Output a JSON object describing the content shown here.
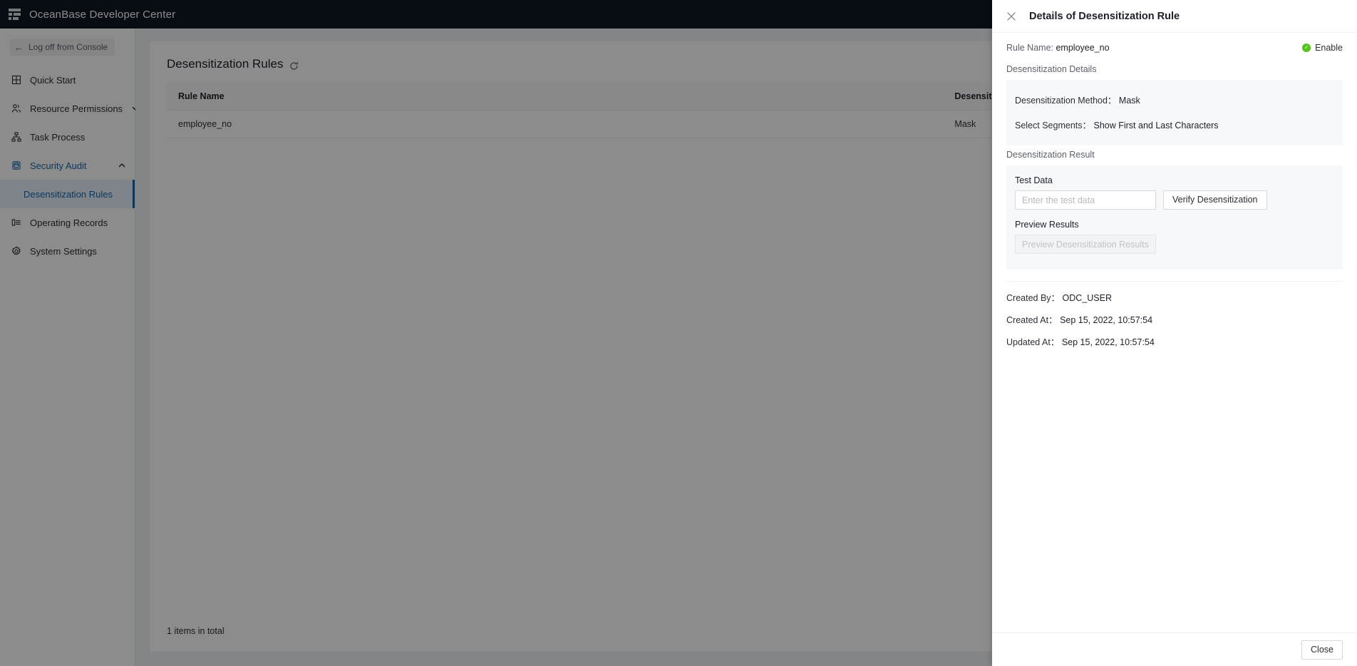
{
  "topbar": {
    "app_title": "OceanBase Developer Center",
    "logo_icon": "menu-logo-icon"
  },
  "sidebar": {
    "logoff": {
      "label": "Log off from Console",
      "icon": "arrow-left-icon"
    },
    "items": [
      {
        "label": "Quick Start",
        "icon": "grid-icon",
        "state": "normal",
        "expandable": false
      },
      {
        "label": "Resource Permissions",
        "icon": "users-icon",
        "state": "normal",
        "expandable": true,
        "caret": "chevron-down-icon"
      },
      {
        "label": "Task Process",
        "icon": "sitemap-icon",
        "state": "normal",
        "expandable": false
      },
      {
        "label": "Security Audit",
        "icon": "shield-db-icon",
        "state": "active",
        "expandable": true,
        "caret": "chevron-up-icon"
      },
      {
        "label": "Operating Records",
        "icon": "list-icon",
        "state": "normal",
        "expandable": false
      },
      {
        "label": "System Settings",
        "icon": "gear-icon",
        "state": "normal",
        "expandable": false
      }
    ],
    "subitem": {
      "label": "Desensitization Rules",
      "state": "selected"
    }
  },
  "main": {
    "page_title": "Desensitization Rules",
    "refresh_icon": "refresh-icon",
    "table": {
      "columns": [
        "Rule Name",
        "Desensit"
      ],
      "rows": [
        {
          "rule_name": "employee_no",
          "desensitization_method": "Mask"
        }
      ]
    },
    "footer_total": "1 items in total"
  },
  "drawer": {
    "close_icon": "close-icon",
    "title": "Details of Desensitization Rule",
    "rule_name_label": "Rule Name:",
    "rule_name_value": "employee_no",
    "status": {
      "label": "Enable",
      "icon": "check-circle-icon",
      "color": "#52c41a"
    },
    "details_section_label": "Desensitization Details",
    "details": [
      {
        "label": "Desensitization Method：",
        "value": "Mask"
      },
      {
        "label": "Select Segments：",
        "value": "Show First and Last Characters"
      }
    ],
    "result_section_label": "Desensitization Result",
    "test_data_label": "Test Data",
    "test_data_placeholder": "Enter the test data",
    "test_data_value": "",
    "verify_button": "Verify Desensitization",
    "preview_label": "Preview Results",
    "preview_placeholder": "Preview Desensitization Results",
    "meta": [
      {
        "label": "Created By：",
        "value": "ODC_USER"
      },
      {
        "label": "Created At：",
        "value": "Sep 15, 2022, 10:57:54"
      },
      {
        "label": "Updated At：",
        "value": "Sep 15, 2022, 10:57:54"
      }
    ],
    "close_button": "Close"
  },
  "colors": {
    "topbar_bg": "#101623",
    "accent": "#1765ad",
    "status_green": "#52c41a",
    "content_bg": "#f0f2f5"
  }
}
